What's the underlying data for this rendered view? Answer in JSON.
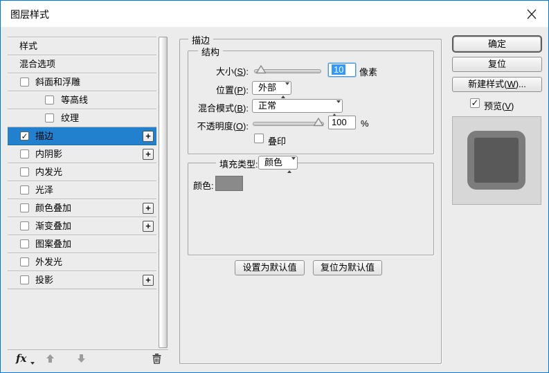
{
  "window": {
    "title": "图层样式"
  },
  "icons": {
    "close": "close-x",
    "plus": "+",
    "check": "✓",
    "fx": "fx",
    "up_arrow": "move-up",
    "down_arrow": "move-down",
    "trash": "delete-trash"
  },
  "colors": {
    "accent_blue": "#0078d7",
    "selection_blue": "#2181ce",
    "stroke_color_swatch": "#8a8a8a",
    "preview_stroke": "#7c7c7c",
    "preview_fill": "#595959"
  },
  "sidebar": {
    "items": [
      {
        "label": "样式",
        "has_checkbox": false,
        "checked": false,
        "selected": false,
        "indent": false,
        "plus": false
      },
      {
        "label": "混合选项",
        "has_checkbox": false,
        "checked": false,
        "selected": false,
        "indent": false,
        "plus": false
      },
      {
        "label": "斜面和浮雕",
        "has_checkbox": true,
        "checked": false,
        "selected": false,
        "indent": false,
        "plus": false
      },
      {
        "label": "等高线",
        "has_checkbox": true,
        "checked": false,
        "selected": false,
        "indent": true,
        "plus": false
      },
      {
        "label": "纹理",
        "has_checkbox": true,
        "checked": false,
        "selected": false,
        "indent": true,
        "plus": false
      },
      {
        "label": "描边",
        "has_checkbox": true,
        "checked": true,
        "selected": true,
        "indent": false,
        "plus": true
      },
      {
        "label": "内阴影",
        "has_checkbox": true,
        "checked": false,
        "selected": false,
        "indent": false,
        "plus": true
      },
      {
        "label": "内发光",
        "has_checkbox": true,
        "checked": false,
        "selected": false,
        "indent": false,
        "plus": false
      },
      {
        "label": "光泽",
        "has_checkbox": true,
        "checked": false,
        "selected": false,
        "indent": false,
        "plus": false
      },
      {
        "label": "颜色叠加",
        "has_checkbox": true,
        "checked": false,
        "selected": false,
        "indent": false,
        "plus": true
      },
      {
        "label": "渐变叠加",
        "has_checkbox": true,
        "checked": false,
        "selected": false,
        "indent": false,
        "plus": true
      },
      {
        "label": "图案叠加",
        "has_checkbox": true,
        "checked": false,
        "selected": false,
        "indent": false,
        "plus": false
      },
      {
        "label": "外发光",
        "has_checkbox": true,
        "checked": false,
        "selected": false,
        "indent": false,
        "plus": false
      },
      {
        "label": "投影",
        "has_checkbox": true,
        "checked": false,
        "selected": false,
        "indent": false,
        "plus": true
      }
    ],
    "footer": {
      "fx_label": "fx"
    }
  },
  "main": {
    "group_title": "描边",
    "structure": {
      "group_title": "结构",
      "size": {
        "label": "大小(S):",
        "value": "10",
        "unit": "像素",
        "slider_percent": 6
      },
      "position": {
        "label": "位置(P):",
        "value": "外部"
      },
      "blend_mode": {
        "label": "混合模式(B):",
        "value": "正常"
      },
      "opacity": {
        "label": "不透明度(O):",
        "value": "100",
        "unit": "%",
        "slider_percent": 100
      },
      "overprint": {
        "label": "叠印",
        "checked": false
      }
    },
    "fill": {
      "type_label": "填充类型:",
      "type_value": "颜色",
      "color_label": "颜色:"
    },
    "buttons": {
      "make_default": "设置为默认值",
      "reset_default": "复位为默认值"
    }
  },
  "actions": {
    "ok": "确定",
    "reset": "复位",
    "new_style": "新建样式(W)...",
    "preview": {
      "label": "预览(V)",
      "checked": true
    }
  }
}
